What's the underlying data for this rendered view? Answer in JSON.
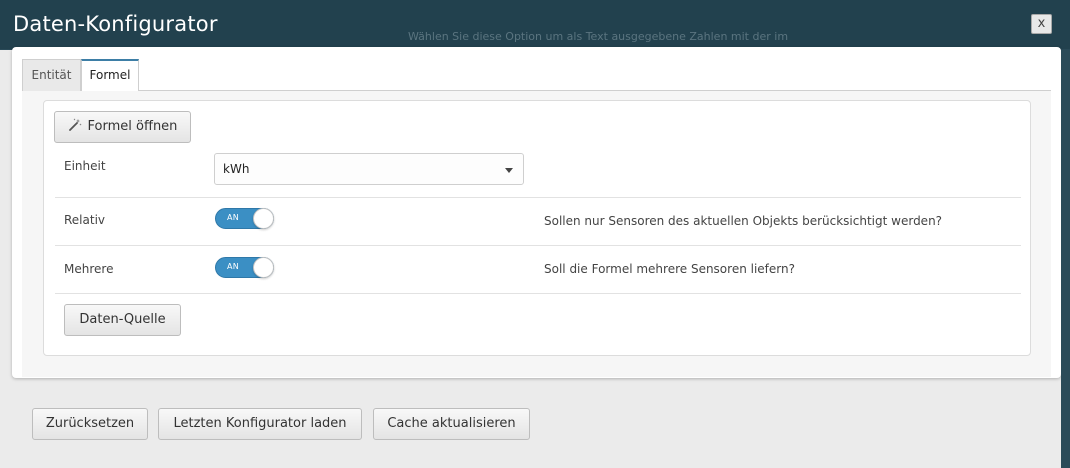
{
  "background": {
    "hint_text": "Wählen Sie diese Option um als Text ausgegebene Zahlen mit der im"
  },
  "dialog": {
    "title": "Daten-Konfigurator",
    "close_label": "x"
  },
  "tabs": [
    {
      "label": "Entität",
      "active": false
    },
    {
      "label": "Formel",
      "active": true
    }
  ],
  "formula": {
    "open_button_label": "Formel öffnen",
    "unit_label": "Einheit",
    "unit_value": "kWh",
    "relative_label": "Relativ",
    "relative_toggle": "AN",
    "relative_description": "Sollen nur Sensoren des aktuellen Objekts berücksichtigt werden?",
    "multiple_label": "Mehrere",
    "multiple_toggle": "AN",
    "multiple_description": "Soll die Formel mehrere Sensoren liefern?",
    "data_source_button_label": "Daten-Quelle"
  },
  "footer": {
    "reset_label": "Zurücksetzen",
    "load_last_label": "Letzten Konfigurator laden",
    "refresh_cache_label": "Cache aktualisieren"
  },
  "colors": {
    "titlebar": "#123442",
    "toggle_on": "#3b8fc4",
    "active_tab_accent": "#3d7ea6"
  }
}
